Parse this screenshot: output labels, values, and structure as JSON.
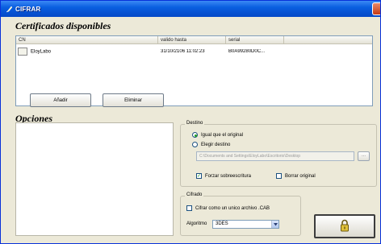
{
  "window": {
    "title": "CIFRAR"
  },
  "certificates": {
    "section_title": "Certificados disponibles",
    "columns": [
      "CN",
      "valido hasta",
      "serial",
      ""
    ],
    "rows": [
      {
        "cn": "EloyLabo",
        "valid_until": "31/10/2106 11:02:23",
        "serial": "B0A99280D0C..."
      }
    ],
    "add_label": "Añadir",
    "remove_label": "Eliminar"
  },
  "options": {
    "section_title": "Opciones",
    "destino": {
      "label": "Destino",
      "same_as_original": "Igual que el original",
      "choose_destination": "Elegir destino",
      "path_placeholder": "C:\\Documents and Settings\\EloyLabo\\Escritorio\\Desktop",
      "browse_label": "...",
      "force_overwrite": "Forzar sobreescritura",
      "delete_original": "Borrar original"
    },
    "cifrado": {
      "label": "Cifrado",
      "single_cab": "Cifrar como un unico archivo .CAB",
      "algorithm_label": "Algoritmo",
      "algorithm_value": "3DES"
    },
    "state": {
      "destino_selected": "same_as_original",
      "force_overwrite": true,
      "delete_original": false,
      "single_cab": false
    }
  },
  "colors": {
    "titlebar": "#0a5fe0",
    "window_bg": "#ece9d8",
    "accent_green": "#21a121"
  }
}
